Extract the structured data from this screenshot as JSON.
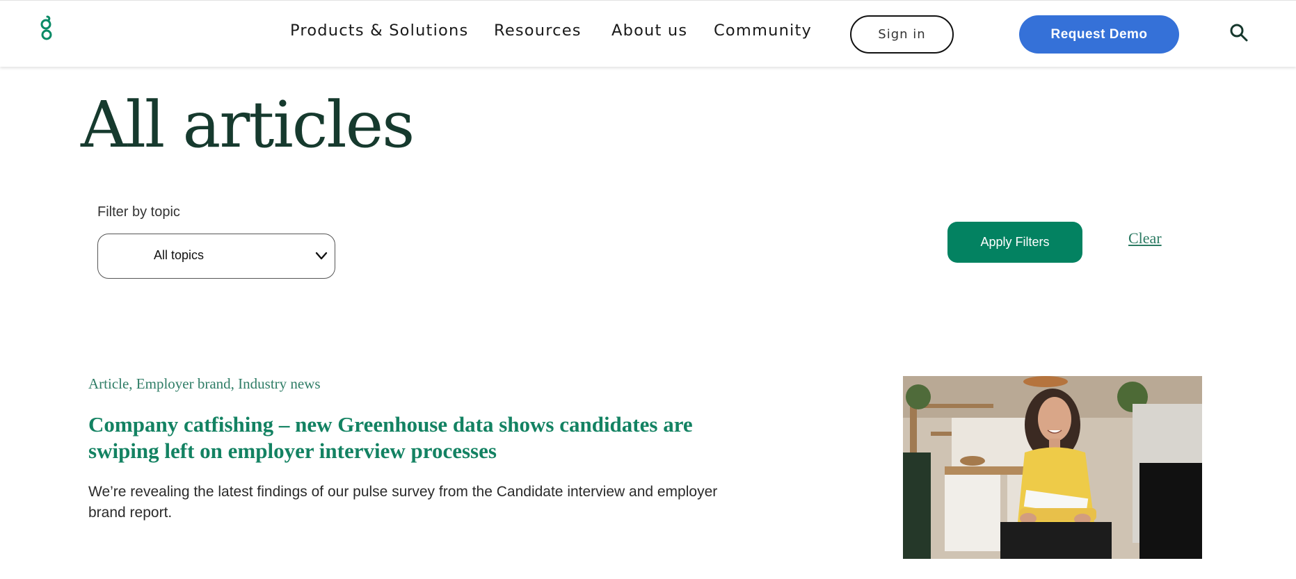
{
  "header": {
    "logo_letter": "g",
    "nav": [
      {
        "label": "Products & Solutions"
      },
      {
        "label": "Resources"
      },
      {
        "label": "About us"
      },
      {
        "label": "Community"
      }
    ],
    "signin_label": "Sign in",
    "demo_label": "Request Demo",
    "search_icon": "search-icon"
  },
  "page": {
    "title": "All articles"
  },
  "filters": {
    "label": "Filter by topic",
    "selected_topic": "All topics",
    "apply_label": "Apply Filters",
    "clear_label": "Clear"
  },
  "article": {
    "tags": "Article, Employer brand, Industry news",
    "title": "Company catfishing – new Greenhouse data shows candidates are swiping left on employer interview processes",
    "description": "We’re revealing the latest findings of our pulse survey from the Candidate interview and employer brand report."
  },
  "colors": {
    "brand_green": "#038261",
    "title_green": "#163a2e",
    "demo_blue": "#3571d8"
  }
}
